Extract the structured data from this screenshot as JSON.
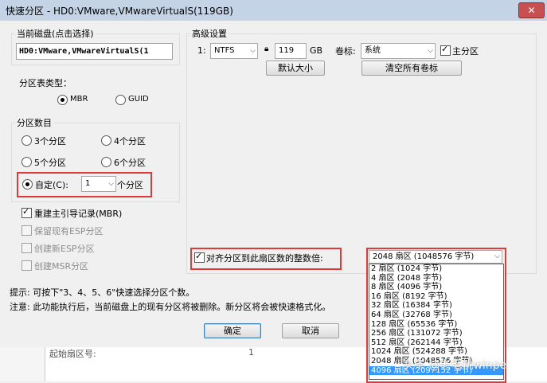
{
  "window": {
    "title": "快速分区 - HD0:VMware,VMwareVirtualS(119GB)",
    "close_glyph": "✕"
  },
  "disk": {
    "legend": "当前磁盘(点击选择)",
    "value": "HD0:VMware,VMwareVirtualS(1"
  },
  "table_type": {
    "legend": "分区表类型：",
    "options": [
      "MBR",
      "GUID"
    ],
    "selected": "MBR"
  },
  "partition_count": {
    "legend": "分区数目",
    "options": [
      "3个分区",
      "4个分区",
      "5个分区",
      "6个分区"
    ],
    "custom_label": "自定(C):",
    "custom_value": "1",
    "custom_suffix": "个分区"
  },
  "checks": {
    "rebuild_mbr": "重建主引导记录(MBR)",
    "keep_esp": "保留现有ESP分区",
    "create_esp": "创建新ESP分区",
    "create_msr": "创建MSR分区"
  },
  "advanced": {
    "legend": "高级设置",
    "row_index": "1:",
    "fs": "NTFS",
    "size": "119",
    "size_unit": "GB",
    "volume_label_caption": "卷标:",
    "volume_label": "系统",
    "primary_label": "主分区",
    "default_size_button": "默认大小",
    "clear_labels_button": "清空所有卷标"
  },
  "align": {
    "label": "对齐分区到此扇区数的整数倍:",
    "selected": "2048 扇区 (1048576 字节)",
    "options": [
      "2 扇区 (1024 字节)",
      "4 扇区 (2048 字节)",
      "8 扇区 (4096 字节)",
      "16 扇区 (8192 字节)",
      "32 扇区 (16384 字节)",
      "64 扇区 (32768 字节)",
      "128 扇区 (65536 字节)",
      "256 扇区 (131072 字节)",
      "512 扇区 (262144 字节)",
      "1024 扇区 (524288 字节)",
      "2048 扇区 (1048576 字节)",
      "4096 扇区 (2097152 字节)"
    ],
    "highlighted_index": 11
  },
  "hints": {
    "tip": "提示: 可按下\"3、4、5、6\"快速选择分区个数。",
    "note": "注意: 此功能执行后，当前磁盘上的现有分区将被删除。新分区将会被快速格式化。"
  },
  "buttons": {
    "ok": "确定",
    "cancel": "取消"
  },
  "background": {
    "label": "起始扇区号:",
    "value": "1"
  },
  "watermark": "头条 @老毛桃winpe"
}
